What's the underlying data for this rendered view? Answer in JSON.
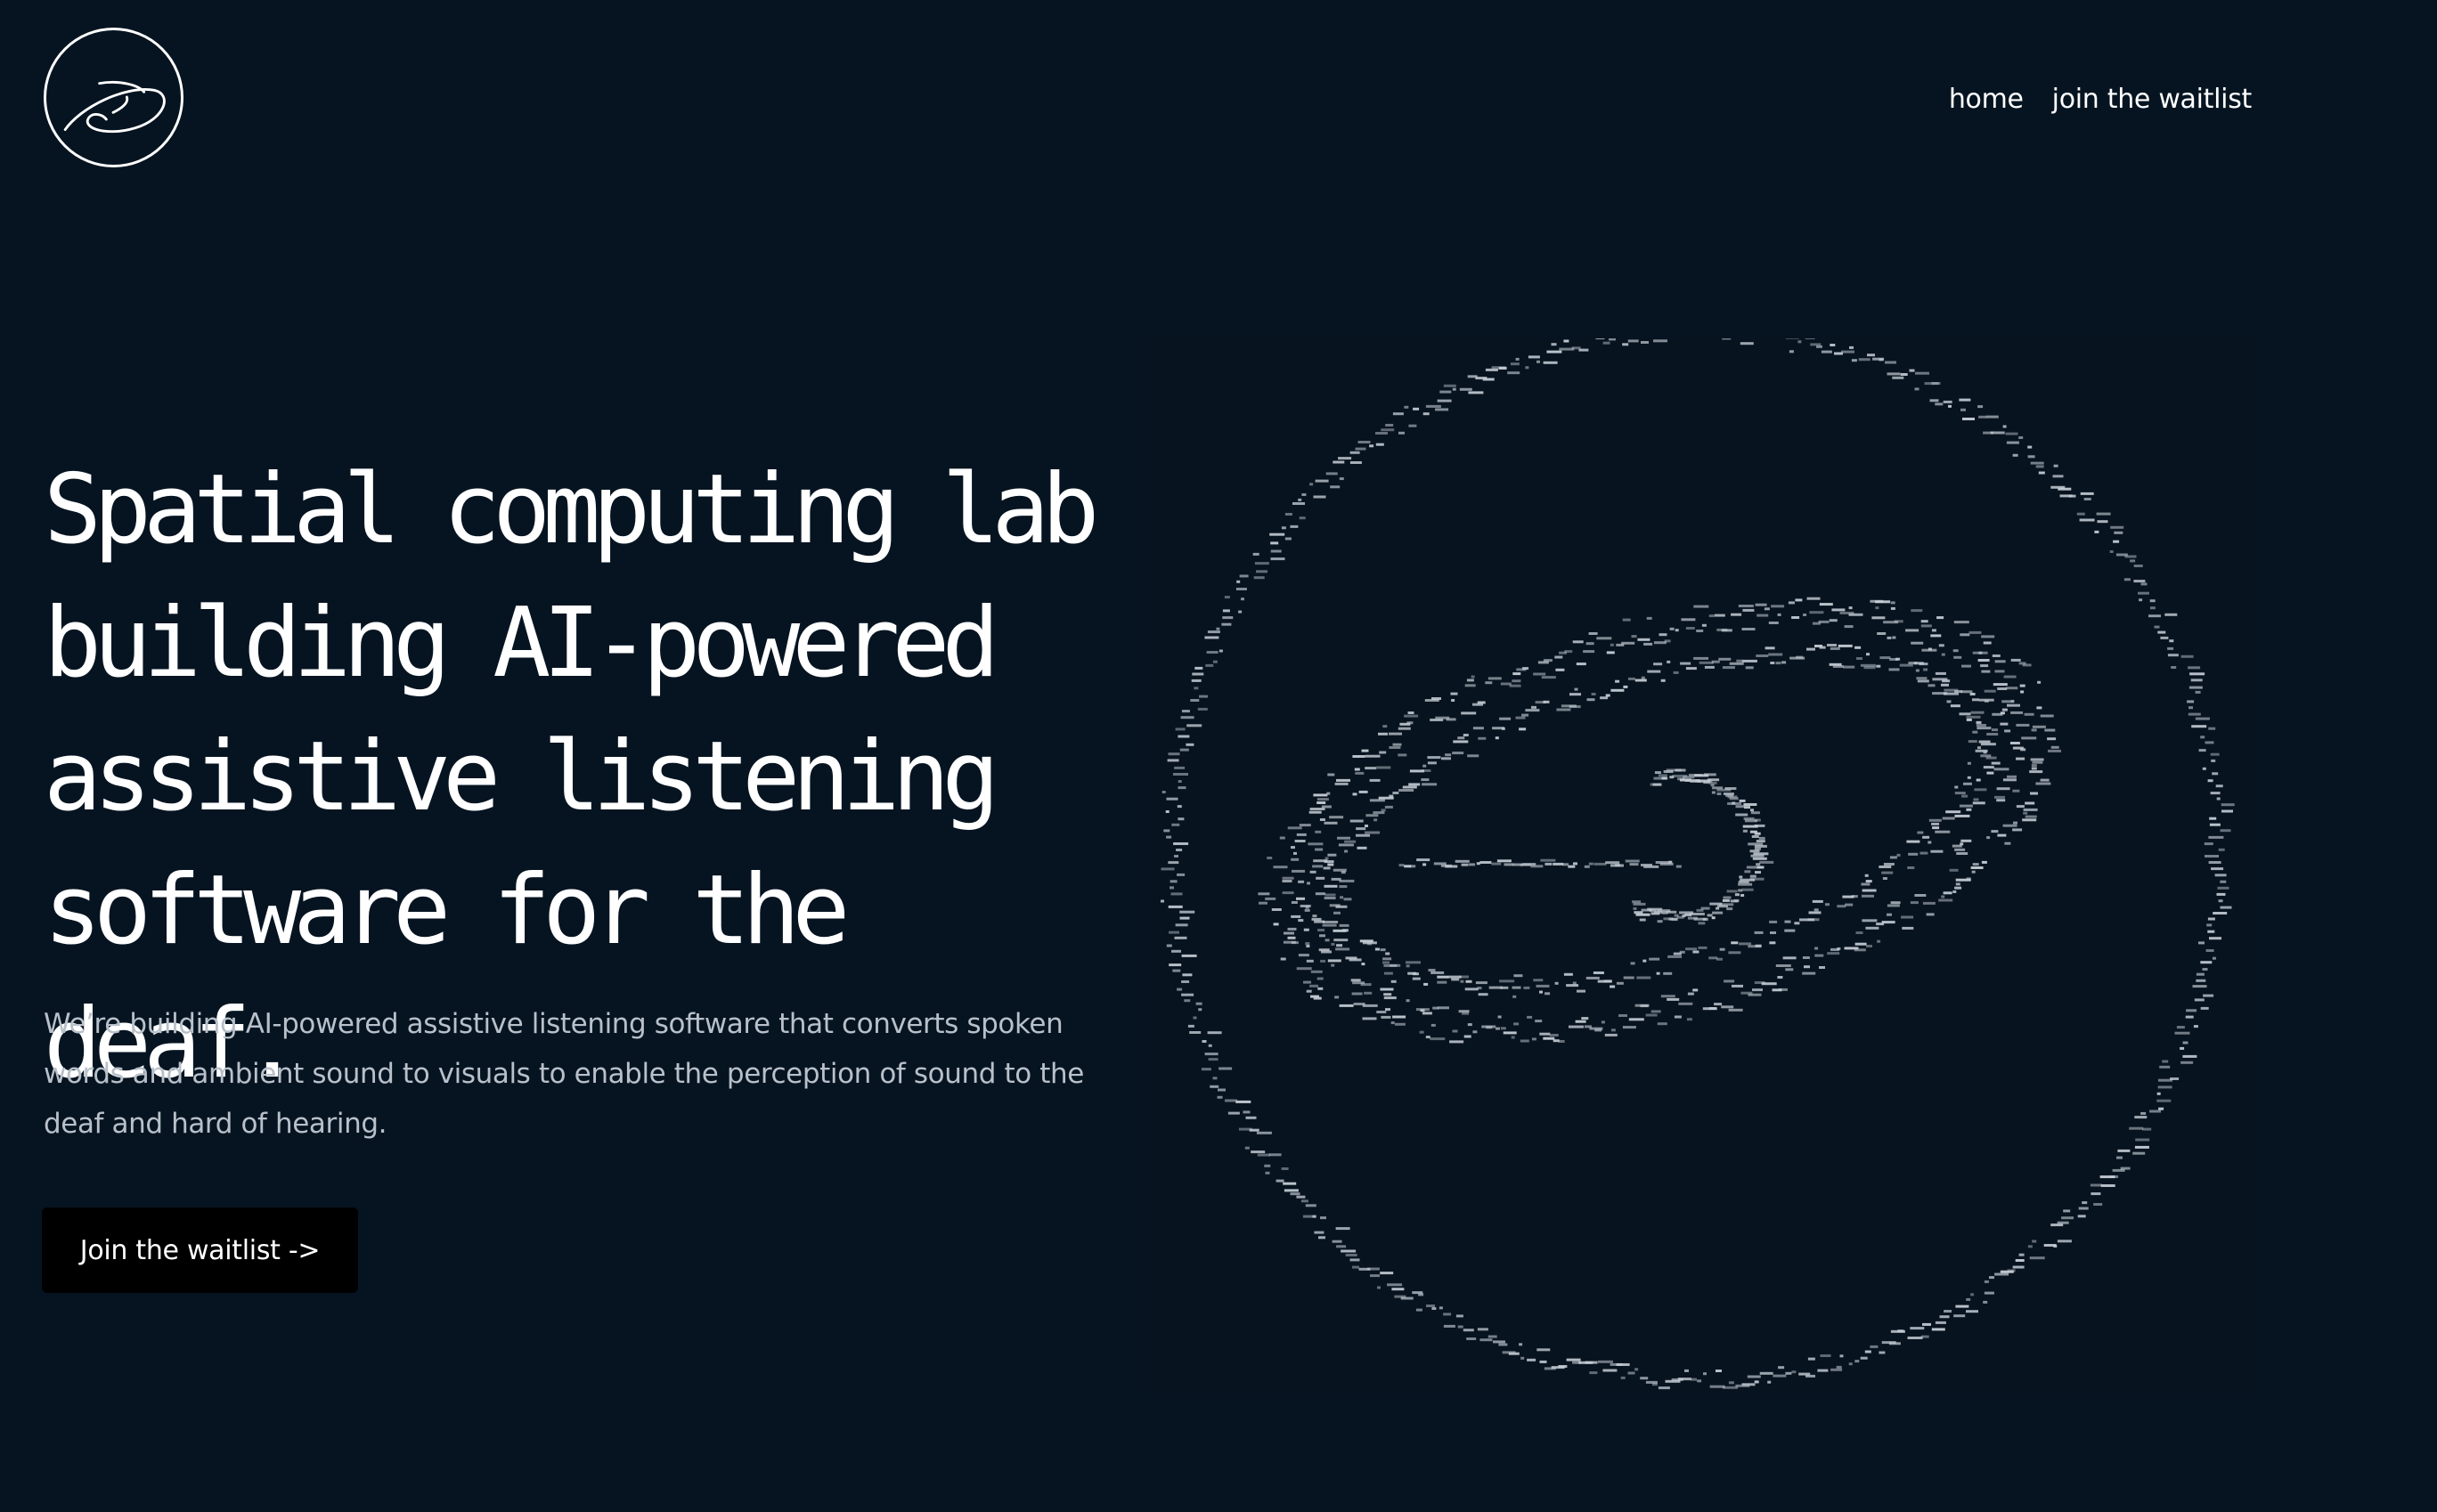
{
  "header": {
    "logo_icon": "swirl-orbit-logo-icon",
    "nav": [
      {
        "label": "home"
      },
      {
        "label": "join the waitlist"
      }
    ]
  },
  "hero": {
    "title_lines": [
      "Spatial computing lab",
      "building AI-powered",
      "assistive listening",
      "software for the deaf."
    ],
    "description": "We’re building AI-powered assistive listening software that converts spoken words and ambient sound to visuals to enable the perception of sound to the deaf and hard of hearing.",
    "cta_label": "Join the waitlist ->"
  },
  "visual": {
    "icon": "ascii-dot-logo-icon"
  },
  "colors": {
    "background": "#061421",
    "text": "#ffffff",
    "muted_text": "#b8c0ca",
    "button_bg": "#000000",
    "ascii_dots": "#c7ced6"
  }
}
